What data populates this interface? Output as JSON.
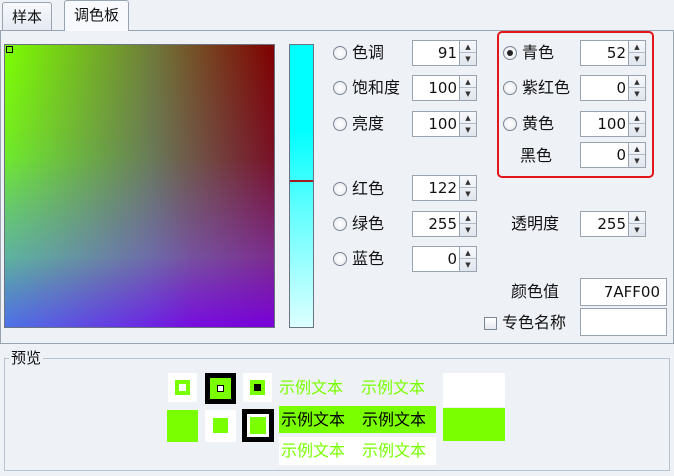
{
  "tabs": [
    {
      "label": "样本"
    },
    {
      "label": "调色板"
    }
  ],
  "hsb": {
    "hue": {
      "label": "色调",
      "value": "91"
    },
    "saturation": {
      "label": "饱和度",
      "value": "100"
    },
    "brightness": {
      "label": "亮度",
      "value": "100"
    }
  },
  "rgb": {
    "red": {
      "label": "红色",
      "value": "122"
    },
    "green": {
      "label": "绿色",
      "value": "255"
    },
    "blue": {
      "label": "蓝色",
      "value": "0"
    }
  },
  "cmyk": {
    "cyan": {
      "label": "青色",
      "value": "52"
    },
    "magenta": {
      "label": "紫红色",
      "value": "0"
    },
    "yellow": {
      "label": "黄色",
      "value": "100"
    },
    "black": {
      "label": "黑色",
      "value": "0"
    }
  },
  "alpha": {
    "label": "透明度",
    "value": "255"
  },
  "color_code": {
    "label": "颜色值",
    "value": "7AFF00"
  },
  "named_color": {
    "label": "专色名称",
    "value": ""
  },
  "preview": {
    "title": "预览",
    "sample_text": "示例文本"
  },
  "colors": {
    "selected": "#7AFF00",
    "highlight_box": "#E3151B"
  }
}
